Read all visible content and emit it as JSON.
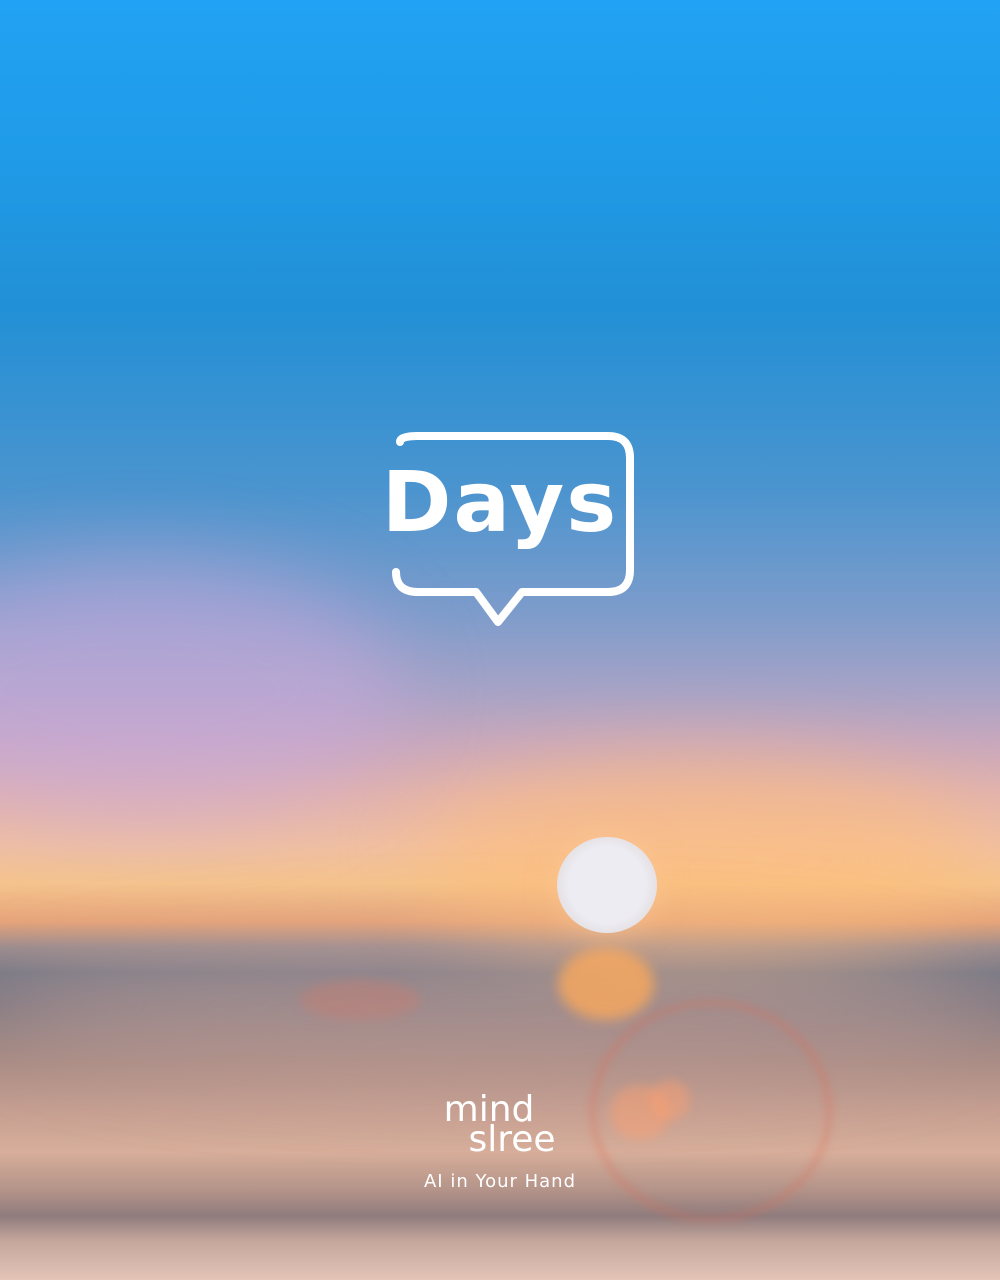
{
  "app": {
    "logo_text": "Days"
  },
  "brand": {
    "line1": "mind",
    "line2": "slree",
    "tagline": "AI in Your Hand"
  },
  "colors": {
    "sky_top": "#22a2f4",
    "horizon": "#f5c48d",
    "logo": "#ffffff"
  },
  "icons": {
    "logo_shape": "speech-bubble-icon",
    "background": "sunset-beach-photo"
  }
}
